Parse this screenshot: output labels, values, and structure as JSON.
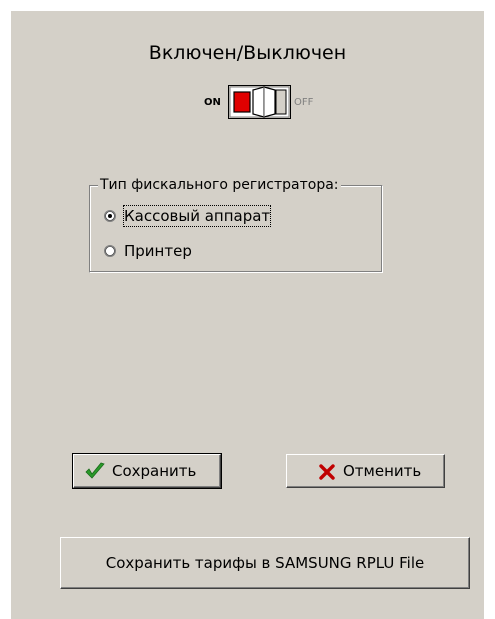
{
  "power": {
    "title": "Включен/Выключен",
    "on_label": "ON",
    "off_label": "OFF"
  },
  "fiscal_type": {
    "legend": "Тип фискального регистратора:",
    "options": [
      {
        "label": "Кассовый аппарат",
        "selected": true
      },
      {
        "label": "Принтер",
        "selected": false
      }
    ]
  },
  "buttons": {
    "save_label": "Сохранить",
    "save_icon": "green-checkmark-icon",
    "cancel_label": "Отменить",
    "cancel_icon": "red-x-icon",
    "save_tariffs_label": "Сохранить тарифы в SAMSUNG RPLU File"
  },
  "colors": {
    "panel_bg": "#d4d0c8",
    "switch_red": "#e00000",
    "check_green": "#2a9a2a",
    "cross_red": "#c00000"
  }
}
